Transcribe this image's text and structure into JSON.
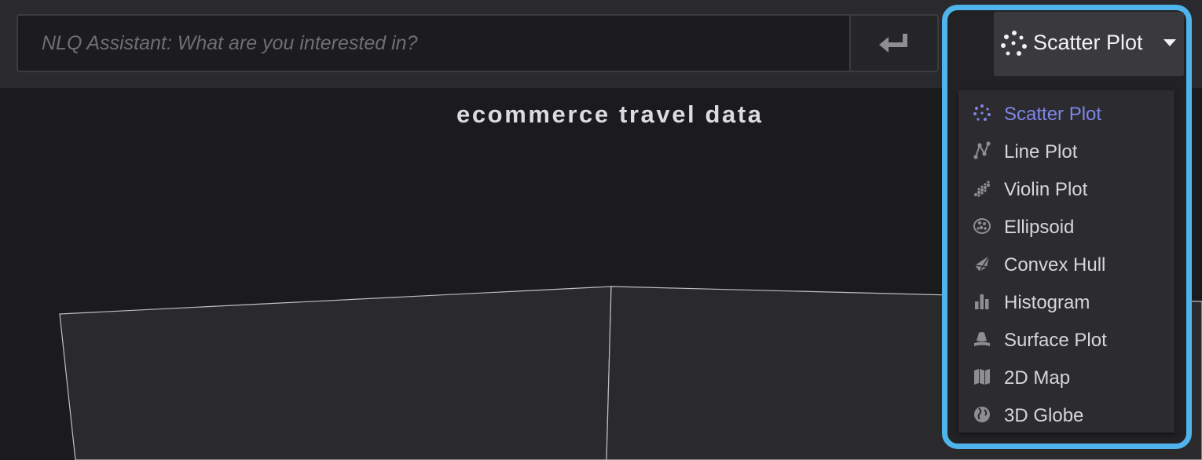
{
  "search": {
    "placeholder": "NLQ Assistant: What are you interested in?",
    "value": "",
    "submit_icon": "enter-return-icon"
  },
  "chart": {
    "title": "ecommerce travel data"
  },
  "plot_selector": {
    "selected": "Scatter Plot",
    "icon": "scatter-plot-icon",
    "expanded": true,
    "highlight_color": "#4fb4ec",
    "active_color": "#7e86e8",
    "options": [
      {
        "label": "Scatter Plot",
        "icon": "scatter-plot-icon",
        "active": true
      },
      {
        "label": "Line Plot",
        "icon": "line-plot-icon",
        "active": false
      },
      {
        "label": "Violin Plot",
        "icon": "violin-plot-icon",
        "active": false
      },
      {
        "label": "Ellipsoid",
        "icon": "ellipsoid-icon",
        "active": false
      },
      {
        "label": "Convex Hull",
        "icon": "convex-hull-icon",
        "active": false
      },
      {
        "label": "Histogram",
        "icon": "histogram-icon",
        "active": false
      },
      {
        "label": "Surface Plot",
        "icon": "surface-plot-icon",
        "active": false
      },
      {
        "label": "2D Map",
        "icon": "map-2d-icon",
        "active": false
      },
      {
        "label": "3D Globe",
        "icon": "globe-3d-icon",
        "active": false
      }
    ]
  }
}
